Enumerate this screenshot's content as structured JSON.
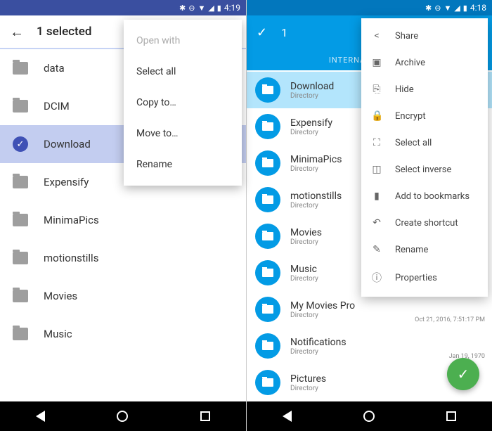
{
  "left": {
    "status_time": "4:19",
    "toolbar_title": "1 selected",
    "items": [
      {
        "name": "data",
        "selected": false
      },
      {
        "name": "DCIM",
        "selected": false
      },
      {
        "name": "Download",
        "selected": true
      },
      {
        "name": "Expensify",
        "selected": false
      },
      {
        "name": "MinimaPics",
        "selected": false
      },
      {
        "name": "motionstills",
        "selected": false
      },
      {
        "name": "Movies",
        "selected": false
      },
      {
        "name": "Music",
        "selected": false
      }
    ],
    "menu": [
      {
        "label": "Open with",
        "disabled": true
      },
      {
        "label": "Select all"
      },
      {
        "label": "Copy to…"
      },
      {
        "label": "Move to…"
      },
      {
        "label": "Rename"
      }
    ]
  },
  "right": {
    "status_time": "4:18",
    "selected_count": "1",
    "subheader": "INTERNAL MEMORY",
    "items": [
      {
        "name": "Download",
        "sub": "Directory",
        "selected": true
      },
      {
        "name": "Expensify",
        "sub": "Directory"
      },
      {
        "name": "MinimaPics",
        "sub": "Directory"
      },
      {
        "name": "motionstills",
        "sub": "Directory"
      },
      {
        "name": "Movies",
        "sub": "Directory"
      },
      {
        "name": "Music",
        "sub": "Directory"
      },
      {
        "name": "My Movies Pro",
        "sub": "Directory",
        "date": "Oct 21, 2016, 7:51:17 PM"
      },
      {
        "name": "Notifications",
        "sub": "Directory",
        "date": "Jan 19, 1970"
      },
      {
        "name": "Pictures",
        "sub": "Directory"
      }
    ],
    "menu": [
      {
        "icon": "share-icon",
        "glyph": "<",
        "label": "Share"
      },
      {
        "icon": "archive-icon",
        "glyph": "▣",
        "label": "Archive"
      },
      {
        "icon": "hide-icon",
        "glyph": "⎘",
        "label": "Hide"
      },
      {
        "icon": "lock-icon",
        "glyph": "🔒",
        "label": "Encrypt"
      },
      {
        "icon": "select-all-icon",
        "glyph": "⛶",
        "label": "Select all"
      },
      {
        "icon": "select-inverse-icon",
        "glyph": "◫",
        "label": "Select inverse"
      },
      {
        "icon": "bookmark-icon",
        "glyph": "▮",
        "label": "Add to bookmarks"
      },
      {
        "icon": "shortcut-icon",
        "glyph": "↶",
        "label": "Create shortcut"
      },
      {
        "icon": "rename-icon",
        "glyph": "✎",
        "label": "Rename"
      },
      {
        "icon": "properties-icon",
        "glyph": "ⓘ",
        "label": "Properties"
      }
    ]
  }
}
